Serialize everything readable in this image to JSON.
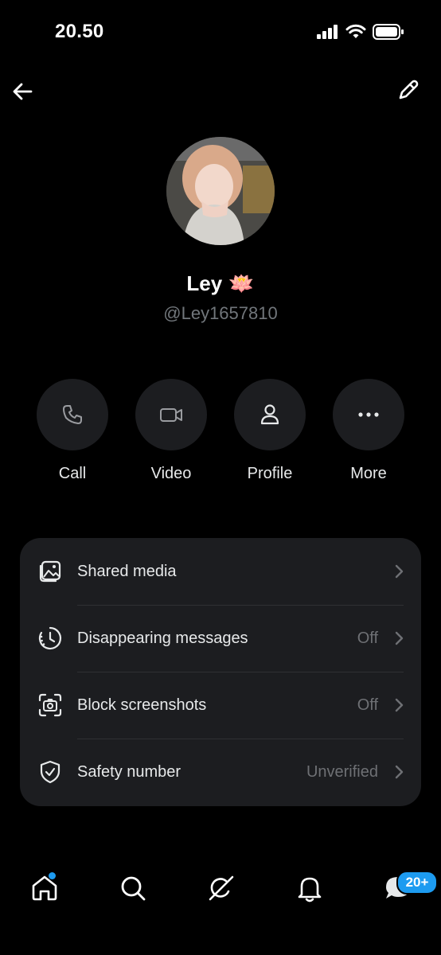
{
  "status_bar": {
    "time": "20.50"
  },
  "profile": {
    "name": "Ley",
    "name_emoji": "🪷",
    "handle": "@Ley1657810"
  },
  "actions": [
    {
      "label": "Call",
      "icon": "phone-icon"
    },
    {
      "label": "Video",
      "icon": "video-camera-icon"
    },
    {
      "label": "Profile",
      "icon": "person-icon"
    },
    {
      "label": "More",
      "icon": "more-dots-icon"
    }
  ],
  "settings": [
    {
      "label": "Shared media",
      "value": "",
      "icon": "photos-icon"
    },
    {
      "label": "Disappearing messages",
      "value": "Off",
      "icon": "timer-icon"
    },
    {
      "label": "Block screenshots",
      "value": "Off",
      "icon": "screenshot-camera-icon"
    },
    {
      "label": "Safety number",
      "value": "Unverified",
      "icon": "shield-check-icon"
    }
  ],
  "bottom_nav": {
    "items": [
      "home-icon",
      "search-icon",
      "grok-icon",
      "notifications-icon",
      "messages-icon"
    ],
    "messages_badge": "20+"
  },
  "colors": {
    "background": "#000000",
    "surface": "#1c1d20",
    "muted_text": "#71767b",
    "accent": "#1d9bf0"
  }
}
